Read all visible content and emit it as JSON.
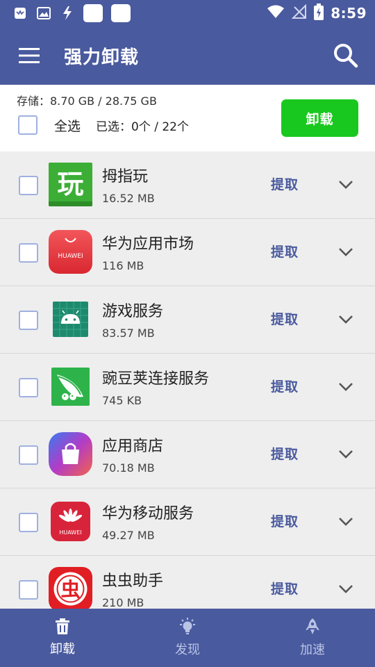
{
  "status_bar": {
    "time": "8:59",
    "left_icons": [
      "notification-app-icon",
      "gallery-icon",
      "lightning-app-icon",
      "blank-app-icon",
      "blank-app-icon"
    ],
    "right_icons": [
      "wifi-icon",
      "no-signal-icon",
      "battery-charging-icon"
    ]
  },
  "app_bar": {
    "title": "强力卸载",
    "menu_icon": "menu-icon",
    "search_icon": "search-icon"
  },
  "header": {
    "storage_text": "存储：8.70 GB / 28.75 GB",
    "select_all_label": "全选",
    "selected_count": "已选：0个 / 22个",
    "uninstall_label": "卸载"
  },
  "apps": [
    {
      "name": "拇指玩",
      "size": "16.52 MB",
      "extract": "提取",
      "icon": "muzhiwan-app-icon",
      "color": "#3cae36"
    },
    {
      "name": "华为应用市场",
      "size": "116 MB",
      "extract": "提取",
      "icon": "huawei-appgallery-icon",
      "color": "#e8353c"
    },
    {
      "name": "游戏服务",
      "size": "83.57 MB",
      "extract": "提取",
      "icon": "game-service-android-icon",
      "color": "#1d8a6e"
    },
    {
      "name": "豌豆荚连接服务",
      "size": "745 KB",
      "extract": "提取",
      "icon": "wandoujia-icon",
      "color": "#2db34a"
    },
    {
      "name": "应用商店",
      "size": "70.18 MB",
      "extract": "提取",
      "icon": "app-store-bag-icon",
      "color": "#7a4bd6"
    },
    {
      "name": "华为移动服务",
      "size": "49.27 MB",
      "extract": "提取",
      "icon": "huawei-mobile-services-icon",
      "color": "#d8243a"
    },
    {
      "name": "虫虫助手",
      "size": "210 MB",
      "extract": "提取",
      "icon": "chongchong-icon",
      "color": "#e01e24"
    }
  ],
  "bottom_nav": [
    {
      "label": "卸载",
      "icon": "trash-icon",
      "active": true
    },
    {
      "label": "发现",
      "icon": "lightbulb-icon",
      "active": false
    },
    {
      "label": "加速",
      "icon": "rocket-icon",
      "active": false
    }
  ],
  "colors": {
    "primary": "#4a5a9e",
    "uninstall_button": "#19c81e",
    "checkbox_border": "#9fb0e0",
    "list_background": "#eeeeee"
  }
}
